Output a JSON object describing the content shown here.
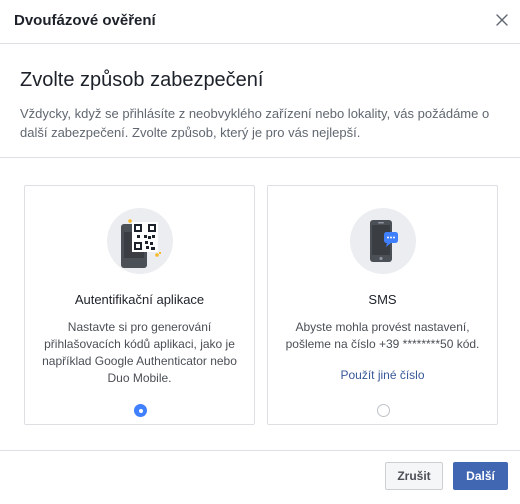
{
  "dialog": {
    "title": "Dvoufázové ověření",
    "close_icon": "close-icon"
  },
  "intro": {
    "heading": "Zvolte způsob zabezpečení",
    "description": "Vždycky, když se přihlásíte z neobvyklého zařízení nebo lokality, vás požádáme o další zabezpečení. Zvolte způsob, který je pro vás nejlepší."
  },
  "options": [
    {
      "name": "Autentifikační aplikace",
      "description": "Nastavte si pro generování přihlašovacích kódů aplikaci, jako je například Google Authenticator nebo Duo Mobile.",
      "icon": "authenticator-app-qr-icon",
      "selected": true
    },
    {
      "name": "SMS",
      "description": "Abyste mohla provést nastavení, pošleme na číslo +39 ********50 kód.",
      "link": "Použít jiné číslo",
      "icon": "phone-sms-icon",
      "selected": false
    }
  ],
  "footer": {
    "cancel_label": "Zrušit",
    "next_label": "Další"
  },
  "colors": {
    "primary": "#4267b2",
    "radio_selected": "#4080ff",
    "link": "#385898",
    "border": "#dddfe2"
  }
}
